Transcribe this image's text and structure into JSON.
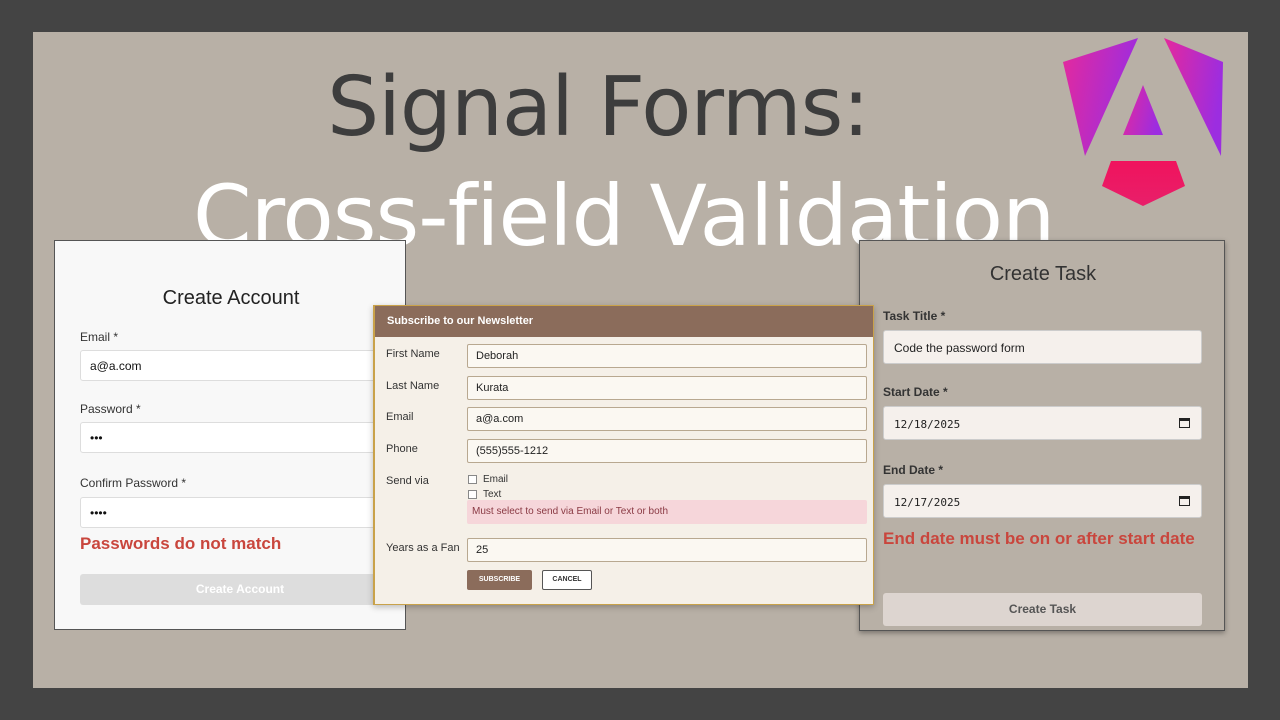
{
  "title": {
    "line1": "Signal Forms:",
    "line2": "Cross-field Validation"
  },
  "colors": {
    "background": "#b8b0a6",
    "error": "#c9463d",
    "newsletter_header": "#8b6c5b",
    "logo_magenta": "#e5299c",
    "logo_purple": "#9c2de0",
    "logo_red": "#f0135d"
  },
  "logo_icon": "angular-logo-icon",
  "create_account": {
    "heading": "Create Account",
    "email_label": "Email *",
    "email_value": "a@a.com",
    "password_label": "Password *",
    "password_value": "•••",
    "confirm_label": "Confirm Password *",
    "confirm_value": "••••",
    "error": "Passwords do not match",
    "button": "Create Account"
  },
  "newsletter": {
    "header": "Subscribe to our Newsletter",
    "first_name_label": "First Name",
    "first_name_value": "Deborah",
    "last_name_label": "Last Name",
    "last_name_value": "Kurata",
    "email_label": "Email",
    "email_value": "a@a.com",
    "phone_label": "Phone",
    "phone_value": "(555)555-1212",
    "send_via_label": "Send via",
    "option_email": "Email",
    "option_text": "Text",
    "alert": "Must select to send via Email or Text or both",
    "years_label": "Years as a Fan",
    "years_value": "25",
    "subscribe": "SUBSCRIBE",
    "cancel": "CANCEL"
  },
  "create_task": {
    "heading": "Create Task",
    "title_label": "Task Title *",
    "title_value": "Code the password form",
    "start_label": "Start Date *",
    "start_value": "12/18/2025",
    "end_label": "End Date *",
    "end_value": "12/17/2025",
    "error": "End date must be on or after start date",
    "button": "Create Task"
  }
}
